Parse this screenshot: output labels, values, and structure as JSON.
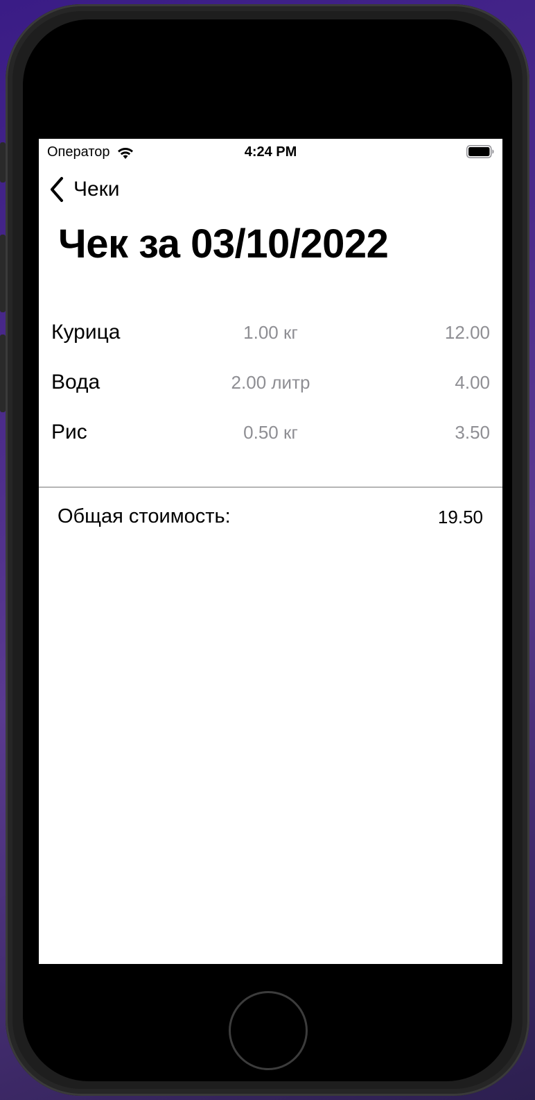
{
  "status_bar": {
    "carrier": "Оператор",
    "time": "4:24 PM"
  },
  "navigation": {
    "back_label": "Чеки"
  },
  "page": {
    "title": "Чек за 03/10/2022"
  },
  "items": [
    {
      "name": "Курица",
      "quantity": "1.00 кг",
      "price": "12.00"
    },
    {
      "name": "Вода",
      "quantity": "2.00 литр",
      "price": "4.00"
    },
    {
      "name": "Рис",
      "quantity": "0.50 кг",
      "price": "3.50"
    }
  ],
  "total": {
    "label": "Общая стоимость:",
    "value": "19.50"
  },
  "icons": {
    "wifi": "wifi-icon",
    "battery": "battery-icon",
    "back": "chevron-left-icon"
  },
  "colors": {
    "primary_text": "#000000",
    "secondary_text": "#8e8e93",
    "divider": "#b5b5b5",
    "background": "#ffffff"
  }
}
